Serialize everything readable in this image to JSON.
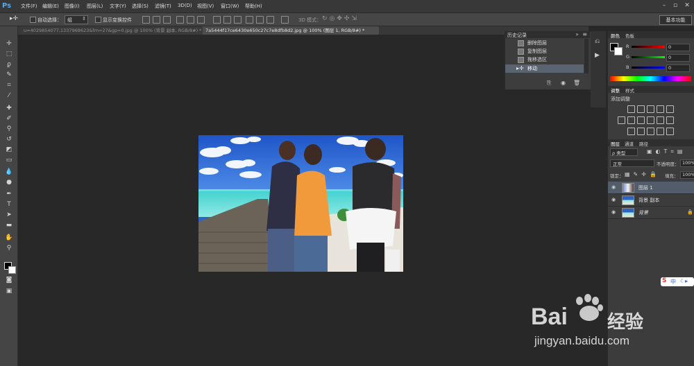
{
  "app": {
    "logo": "Ps"
  },
  "menu": [
    "文件(F)",
    "编辑(E)",
    "图像(I)",
    "图层(L)",
    "文字(Y)",
    "选择(S)",
    "滤镜(T)",
    "3D(D)",
    "视图(V)",
    "窗口(W)",
    "帮助(H)"
  ],
  "options": {
    "auto_select_label": "自动选择：",
    "auto_select_value": "组",
    "show_transform_label": "显示变换控件",
    "mode_3d_label": "3D 模式：",
    "workspace": "基本功能"
  },
  "tabs": [
    {
      "label": "u=4029854077,1337968623&fm=27&gp=0.jpg @ 100% (背景 副本, RGB/8#) *"
    },
    {
      "label": "7a5444f17ce6430e650c27c7e8dfb8d2.jpg @ 100% (图层 1, RGB/8#) *"
    }
  ],
  "history": {
    "title": "历史记录",
    "items": [
      "删除图层",
      "复制图层",
      "拖移选区",
      "移动"
    ],
    "active_index": 3
  },
  "color_panel": {
    "tabs": [
      "颜色",
      "色板"
    ],
    "channels": [
      {
        "label": "R",
        "value": "0"
      },
      {
        "label": "G",
        "value": "0"
      },
      {
        "label": "B",
        "value": "0"
      }
    ]
  },
  "adjust_panel": {
    "tabs": [
      "调整",
      "样式"
    ],
    "title": "添加调整"
  },
  "layers_panel": {
    "tabs": [
      "图层",
      "通道",
      "路径"
    ],
    "filter_label": "ρ 类型",
    "blend_mode": "正常",
    "opacity_label": "不透明度：",
    "opacity_value": "100%",
    "lock_label": "锁定：",
    "fill_label": "填充：",
    "fill_value": "100%",
    "layers": [
      {
        "name": "图层 1",
        "active": true
      },
      {
        "name": "背景 副本",
        "active": false
      },
      {
        "name": "背景",
        "active": false,
        "locked": true
      }
    ]
  },
  "watermark": {
    "brand": "Bai",
    "brand2": "经验",
    "url": "jingyan.baidu.com"
  },
  "ime": {
    "label": "中"
  }
}
